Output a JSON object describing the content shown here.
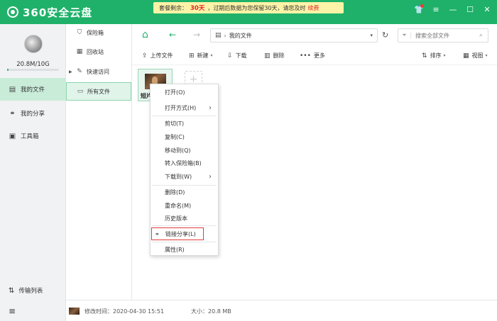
{
  "app": {
    "logo_text": "360安全云盘",
    "notice": {
      "prefix": "套餐剩余：",
      "days": "30天",
      "suffix": "，过期后数据为您保留30天，请您及时",
      "renew": "续费"
    }
  },
  "user": {
    "quota": "20.8M/10G",
    "quota_fraction": 0.002
  },
  "leftnav": {
    "items": [
      {
        "label": "我的文件",
        "icon": "file-icon"
      },
      {
        "label": "我的分享",
        "icon": "share-icon"
      },
      {
        "label": "工具箱",
        "icon": "toolbox-icon"
      }
    ],
    "transfer_label": "传输列表"
  },
  "tree": {
    "items": [
      {
        "label": "保险箱",
        "icon": "shield-icon"
      },
      {
        "label": "回收站",
        "icon": "trash-icon"
      },
      {
        "label": "快速访问",
        "icon": "quick-access-icon"
      },
      {
        "label": "所有文件",
        "icon": "folder-icon"
      }
    ]
  },
  "address": {
    "path": "我的文件",
    "search_placeholder": "搜索全部文件"
  },
  "toolbar": {
    "upload": "上传文件",
    "new": "新建",
    "download": "下载",
    "delete": "删除",
    "more": "更多",
    "sort": "排序",
    "view": "视图"
  },
  "file": {
    "name": "短片"
  },
  "context_menu": {
    "open": "打开(O)",
    "open_with": "打开方式(H)",
    "cut": "剪切(T)",
    "copy": "复制(C)",
    "move_to": "移动到(Q)",
    "to_vault": "转入保险箱(B)",
    "download_to": "下载到(W)",
    "delete": "删除(D)",
    "rename": "重命名(M)",
    "history": "历史版本",
    "link_share": "链接分享(L)",
    "properties": "属性(R)"
  },
  "status": {
    "modified": "修改时间：2020-04-30 15:51",
    "size": "大小：20.8 MB"
  },
  "colors": {
    "brand": "#1fb169",
    "highlight": "#e03c3c"
  }
}
